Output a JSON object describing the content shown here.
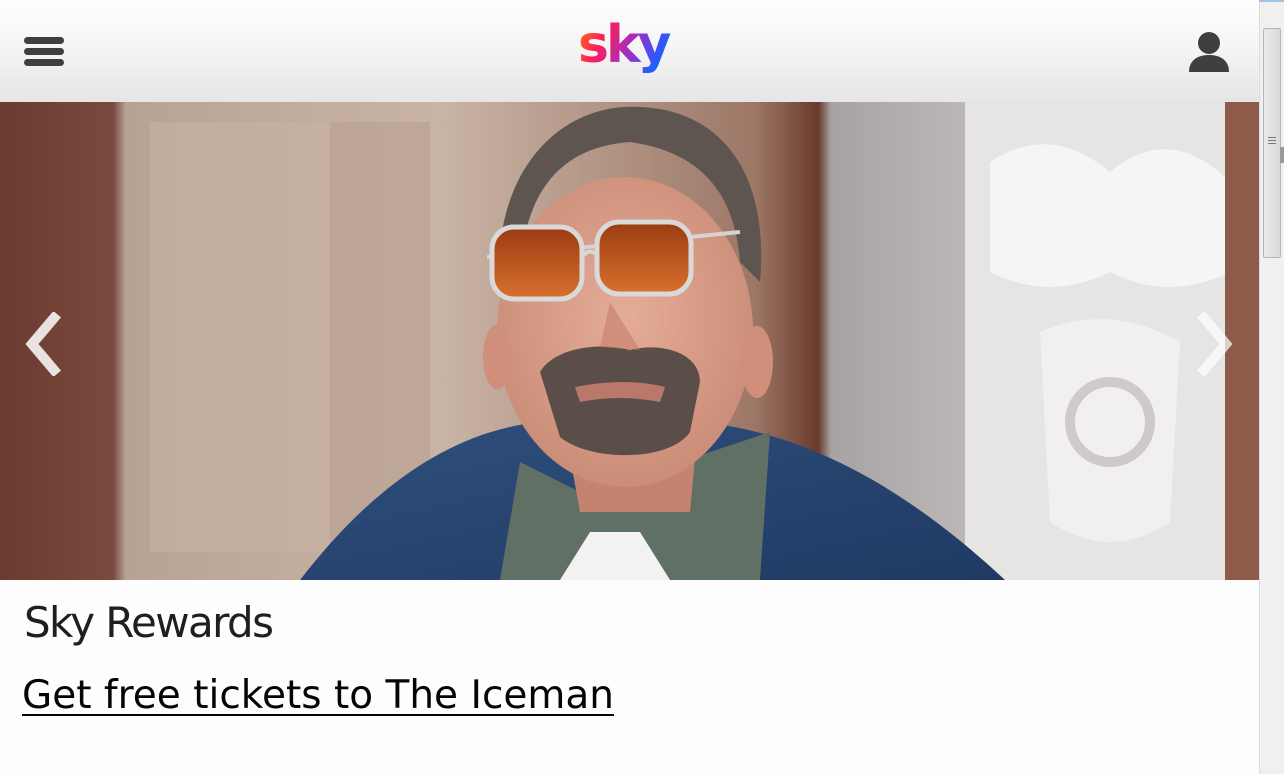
{
  "header": {
    "logo_text": "sky",
    "menu_icon": "hamburger-menu-icon",
    "account_icon": "user-account-icon"
  },
  "hero": {
    "prev_icon": "chevron-left-icon",
    "next_icon": "chevron-right-icon"
  },
  "content": {
    "brand_title": "Sky Rewards",
    "headline": "Get free tickets to The Iceman"
  },
  "colors": {
    "header_bg": "#efefef",
    "text_dark": "#1f1f1f",
    "logo_gradient": [
      "#ff8a00",
      "#ff1e56",
      "#9b2fc9",
      "#1f5fff"
    ]
  }
}
